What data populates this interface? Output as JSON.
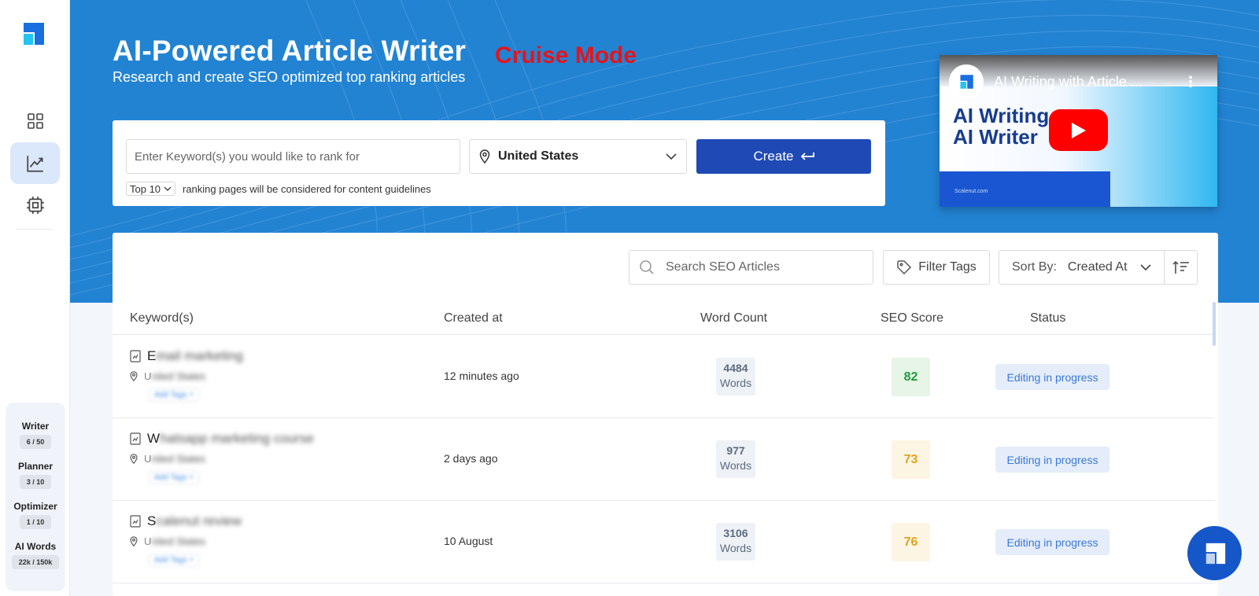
{
  "colors": {
    "hero_bg": "#2283d3",
    "primary": "#1f4ab6",
    "cruise": "#e5141b",
    "score_high": "#1e9b3a",
    "score_mid": "#e3a21a"
  },
  "sidebar": {
    "nav": [
      {
        "icon": "grid-icon"
      },
      {
        "icon": "chart-line-icon",
        "active": true
      },
      {
        "icon": "chip-icon"
      }
    ],
    "usage": [
      {
        "label": "Writer",
        "value": "6 / 50"
      },
      {
        "label": "Planner",
        "value": "3 / 10"
      },
      {
        "label": "Optimizer",
        "value": "1 / 10"
      },
      {
        "label": "AI Words",
        "value": "22k / 150k"
      }
    ]
  },
  "hero": {
    "title": "AI-Powered Article Writer",
    "subtitle": "Research and create SEO optimized top ranking articles",
    "mode": "Cruise Mode"
  },
  "create_form": {
    "keyword_placeholder": "Enter Keyword(s) you would like to rank for",
    "location": "United States",
    "create_label": "Create",
    "top_n": "Top 10",
    "top_n_note": "ranking pages will be considered for content guidelines"
  },
  "video": {
    "title": "AI Writing with Article ...",
    "heading_line1": "AI Writing",
    "heading_line2": "AI Writer",
    "small_text": "Scalenut.com"
  },
  "toolbar": {
    "search_placeholder": "Search SEO Articles",
    "filter_label": "Filter Tags",
    "sort_label": "Sort By:",
    "sort_value": "Created At"
  },
  "table": {
    "headers": {
      "keyword": "Keyword(s)",
      "created": "Created at",
      "words": "Word Count",
      "score": "SEO Score",
      "status": "Status"
    },
    "rows": [
      {
        "kw_first": "E",
        "kw_rest": "mail marketing",
        "loc_first": "U",
        "loc_rest": "nited States",
        "tag": "Add Tags +",
        "created": "12 minutes ago",
        "words": "4484",
        "words_unit": "Words",
        "score": "82",
        "score_level": "high",
        "status": "Editing in progress"
      },
      {
        "kw_first": "W",
        "kw_rest": "hatsapp marketing course",
        "loc_first": "U",
        "loc_rest": "nited States",
        "tag": "Add Tags +",
        "created": "2 days ago",
        "words": "977",
        "words_unit": "Words",
        "score": "73",
        "score_level": "mid",
        "status": "Editing in progress"
      },
      {
        "kw_first": "S",
        "kw_rest": "calenut review",
        "loc_first": "U",
        "loc_rest": "nited States",
        "tag": "Add Tags +",
        "created": "10 August",
        "words": "3106",
        "words_unit": "Words",
        "score": "76",
        "score_level": "mid",
        "status": "Editing in progress"
      }
    ]
  }
}
